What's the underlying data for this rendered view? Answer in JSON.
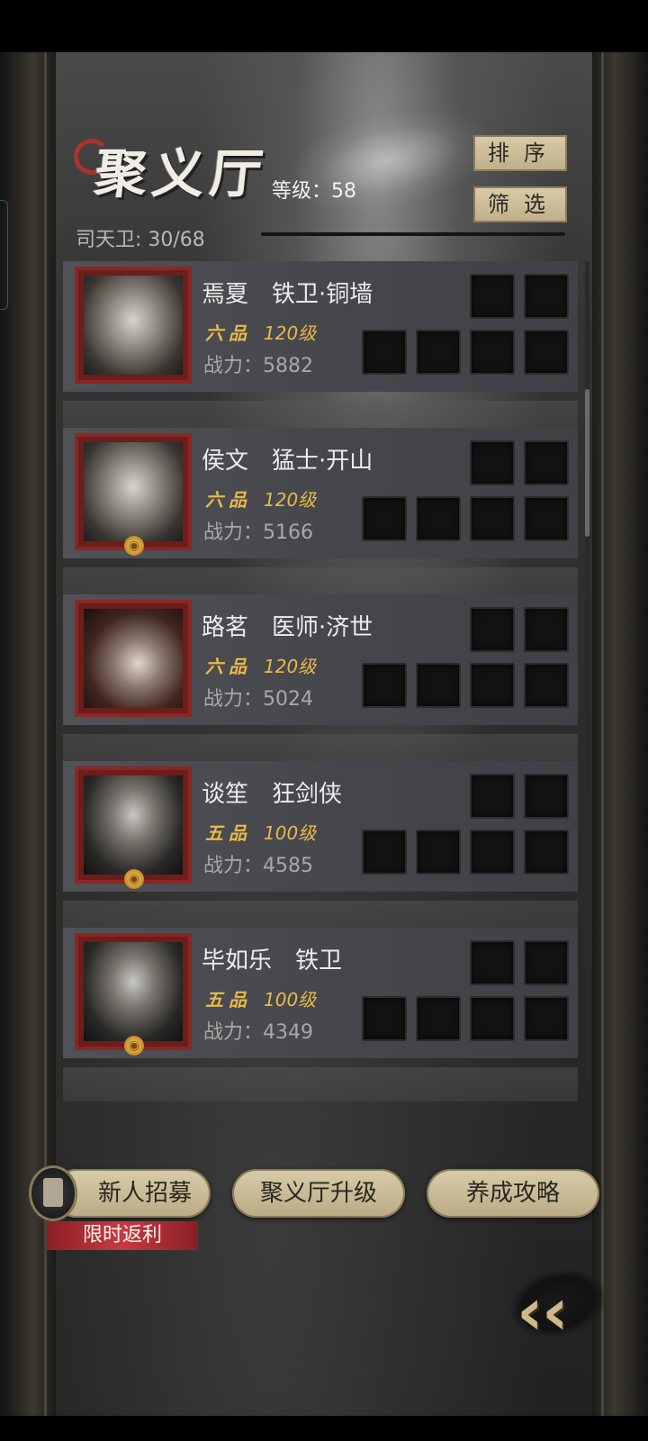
{
  "header": {
    "title": "聚义厅",
    "level_label": "等级：58",
    "guard_count": "司天卫: 30/68",
    "sort_label": "排序",
    "filter_label": "筛选"
  },
  "heroes": [
    {
      "name": "焉夏　铁卫·铜墙",
      "grade": "六品",
      "level": "120级",
      "power": "战力：5882",
      "portrait": "armored-guard",
      "has_coin": false
    },
    {
      "name": "侯文　猛士·开山",
      "grade": "六品",
      "level": "120级",
      "power": "战力：5166",
      "portrait": "skull-headdress-warrior",
      "has_coin": true
    },
    {
      "name": "路茗　医师·济世",
      "grade": "六品",
      "level": "120级",
      "power": "战力：5024",
      "portrait": "healer-woman",
      "has_coin": false
    },
    {
      "name": "谈笙　狂剑侠",
      "grade": "五品",
      "level": "100级",
      "power": "战力：4585",
      "portrait": "white-hair-swordsman",
      "has_coin": true
    },
    {
      "name": "毕如乐　铁卫",
      "grade": "五品",
      "level": "100级",
      "power": "战力：4349",
      "portrait": "helmet-guard",
      "has_coin": true
    }
  ],
  "bottom": {
    "recruit_label": "新人招募",
    "promo_label": "限时返利",
    "upgrade_label": "聚义厅升级",
    "guide_label": "养成攻略"
  },
  "colors": {
    "accent_gold": "#e8b94a",
    "button_tan": "#d8cda9",
    "frame_red": "#8c2622",
    "promo_red": "#c93a43"
  }
}
